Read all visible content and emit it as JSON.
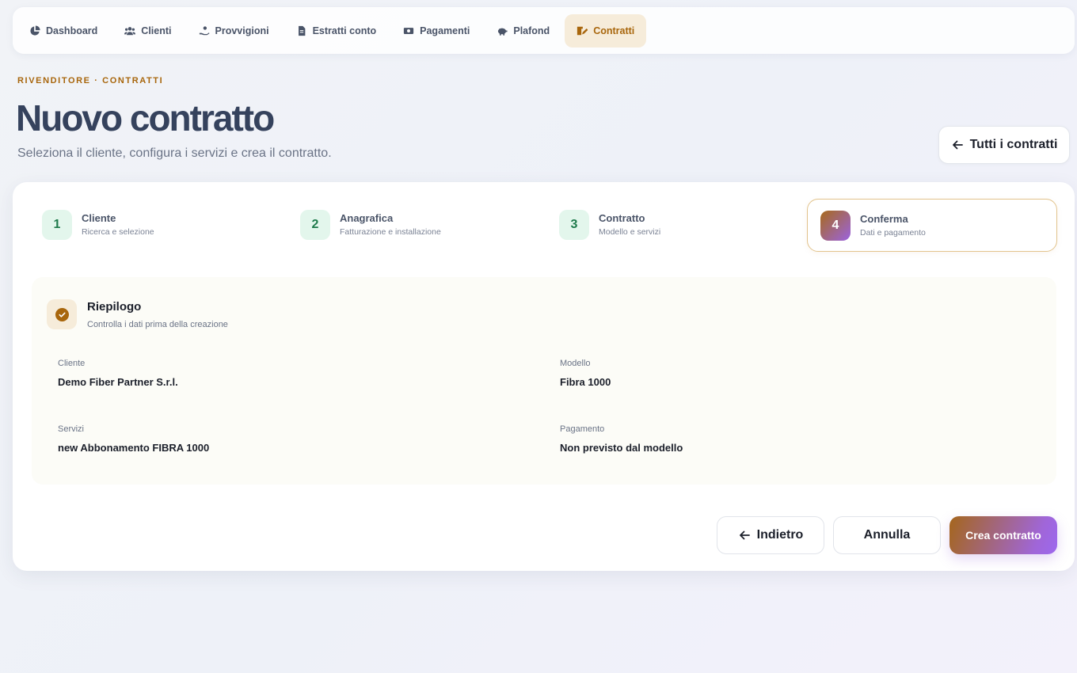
{
  "nav": {
    "items": [
      {
        "label": "Dashboard",
        "icon": "pie-chart-icon"
      },
      {
        "label": "Clienti",
        "icon": "users-icon"
      },
      {
        "label": "Provvigioni",
        "icon": "hand-coin-icon"
      },
      {
        "label": "Estratti conto",
        "icon": "document-icon"
      },
      {
        "label": "Pagamenti",
        "icon": "money-bill-icon"
      },
      {
        "label": "Plafond",
        "icon": "piggy-bank-icon"
      },
      {
        "label": "Contratti",
        "icon": "contract-sign-icon",
        "active": true
      }
    ],
    "accent_color": "#a8660c"
  },
  "header": {
    "eyebrow": "RIVENDITORE · CONTRATTI",
    "title": "Nuovo contratto",
    "subtitle": "Seleziona il cliente, configura i servizi e crea il contratto.",
    "back_all_label": "Tutti i contratti"
  },
  "steps": [
    {
      "num": "1",
      "label": "Cliente",
      "sub": "Ricerca e selezione"
    },
    {
      "num": "2",
      "label": "Anagrafica",
      "sub": "Fatturazione e installazione"
    },
    {
      "num": "3",
      "label": "Contratto",
      "sub": "Modello e servizi"
    },
    {
      "num": "4",
      "label": "Conferma",
      "sub": "Dati e pagamento",
      "active": true
    }
  ],
  "summary": {
    "title": "Riepilogo",
    "subtitle": "Controlla i dati prima della creazione",
    "fields": {
      "cliente": {
        "label": "Cliente",
        "value": "Demo Fiber Partner S.r.l."
      },
      "modello": {
        "label": "Modello",
        "value": "Fibra 1000"
      },
      "servizi": {
        "label": "Servizi",
        "value": "new Abbonamento FIBRA 1000"
      },
      "pagamento": {
        "label": "Pagamento",
        "value": "Non previsto dal modello"
      }
    }
  },
  "actions": {
    "back_label": "Indietro",
    "cancel_label": "Annulla",
    "create_label": "Crea contratto"
  }
}
